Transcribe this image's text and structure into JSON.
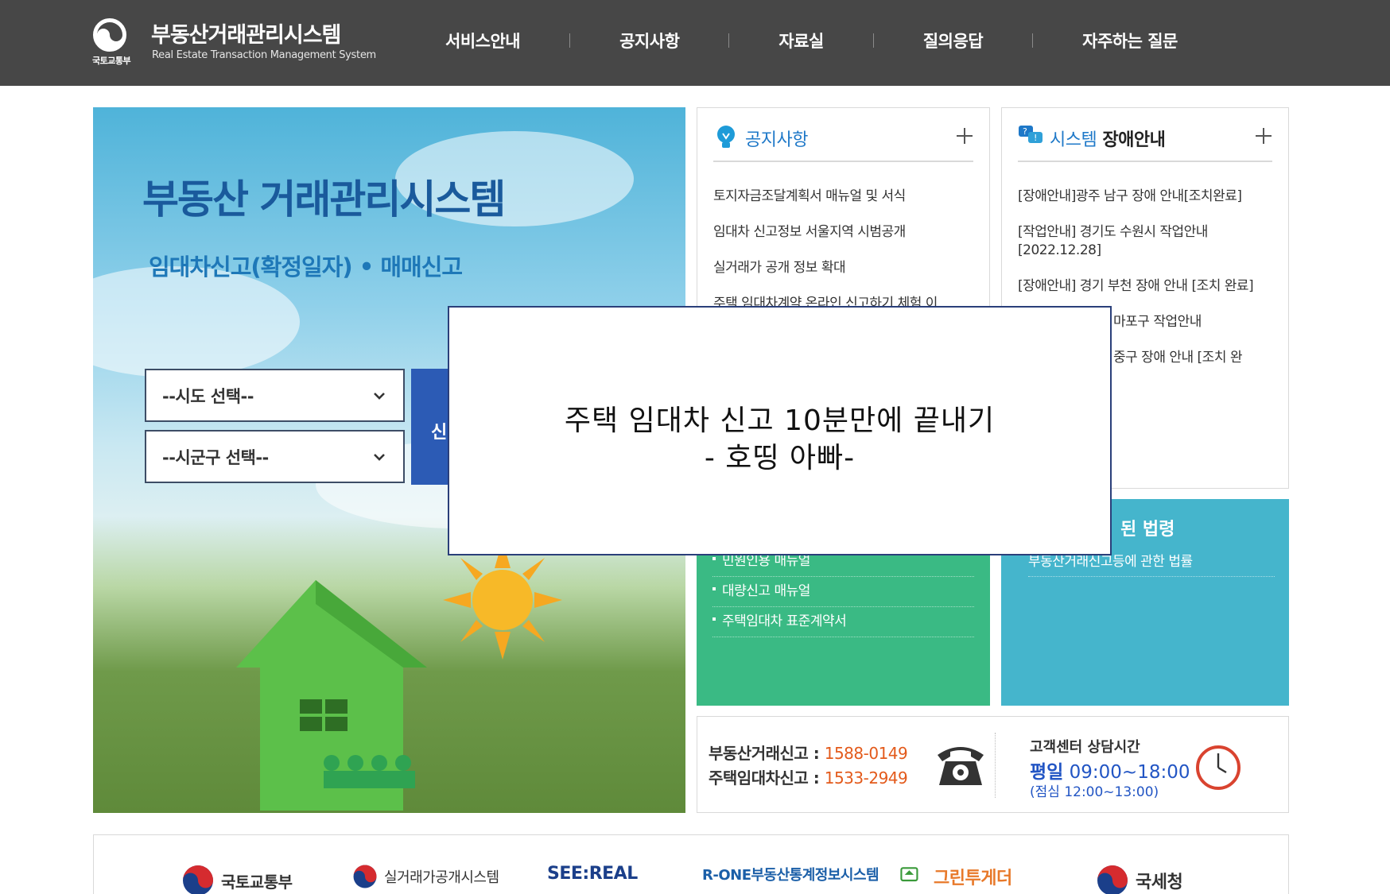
{
  "header": {
    "ministry": "국토교통부",
    "title": "부동산거래관리시스템",
    "subtitle": "Real Estate Transaction Management System",
    "nav": [
      "서비스안내",
      "공지사항",
      "자료실",
      "질의응답",
      "자주하는 질문"
    ]
  },
  "hero": {
    "title": "부동산 거래관리시스템",
    "subtitle": "임대차신고(확정일자) • 매매신고",
    "select_sido": "--시도 선택--",
    "select_sigungu": "--시군구 선택--",
    "button_label": "신"
  },
  "notice": {
    "title": "공지사항",
    "items": [
      "토지자금조달계획서 매뉴얼 및 서식",
      "임대차 신고정보 서울지역 시범공개",
      "실거래가 공개 정보 확대",
      "주택 임대차계약 온라인 신고하기 체험 이"
    ]
  },
  "outage": {
    "title_accent": "시스템",
    "title_rest": "장애안내",
    "items": [
      "[장애안내]광주 남구 장애 안내[조치완료]",
      "[작업안내] 경기도 수원시 작업안내 [2022.12.28]",
      "[장애안내] 경기 부천 장애 안내 [조치 완료]",
      "마포구 작업안내",
      "중구 장애 안내 [조치 완"
    ]
  },
  "downloads": {
    "items": [
      "민원인용 매뉴얼",
      "대량신고 매뉴얼",
      "주택임대차 표준계약서"
    ]
  },
  "laws": {
    "title": "된 법령",
    "item": "부동산거래신고등에 관한 법률"
  },
  "contact": {
    "trade_label": "부동산거래신고 : ",
    "trade_number": "1588-0149",
    "lease_label": "주택임대차신고 : ",
    "lease_number": "1533-2949",
    "hours_label": "고객센터 상담시간",
    "hours_weekday": "평일",
    "hours_time": "09:00~18:00",
    "hours_lunch": "(점심 12:00~13:00)"
  },
  "footer": {
    "links": [
      "국토교통부",
      "실거래가공개시스템",
      "SEE:REAL",
      "R-ONE부동산통계정보시스템",
      "그린투게더",
      "국세청"
    ]
  },
  "overlay": {
    "line1": "주택 임대차 신고 10분만에 끝내기",
    "line2": "- 호띵 아빠-"
  },
  "colors": {
    "header_bg": "#474747",
    "accent_blue": "#2c5bb5",
    "green_panel": "#3aba84",
    "blue_panel": "#45b5cc",
    "phone_number": "#e35a1b",
    "notice_title": "#1e78c8"
  }
}
